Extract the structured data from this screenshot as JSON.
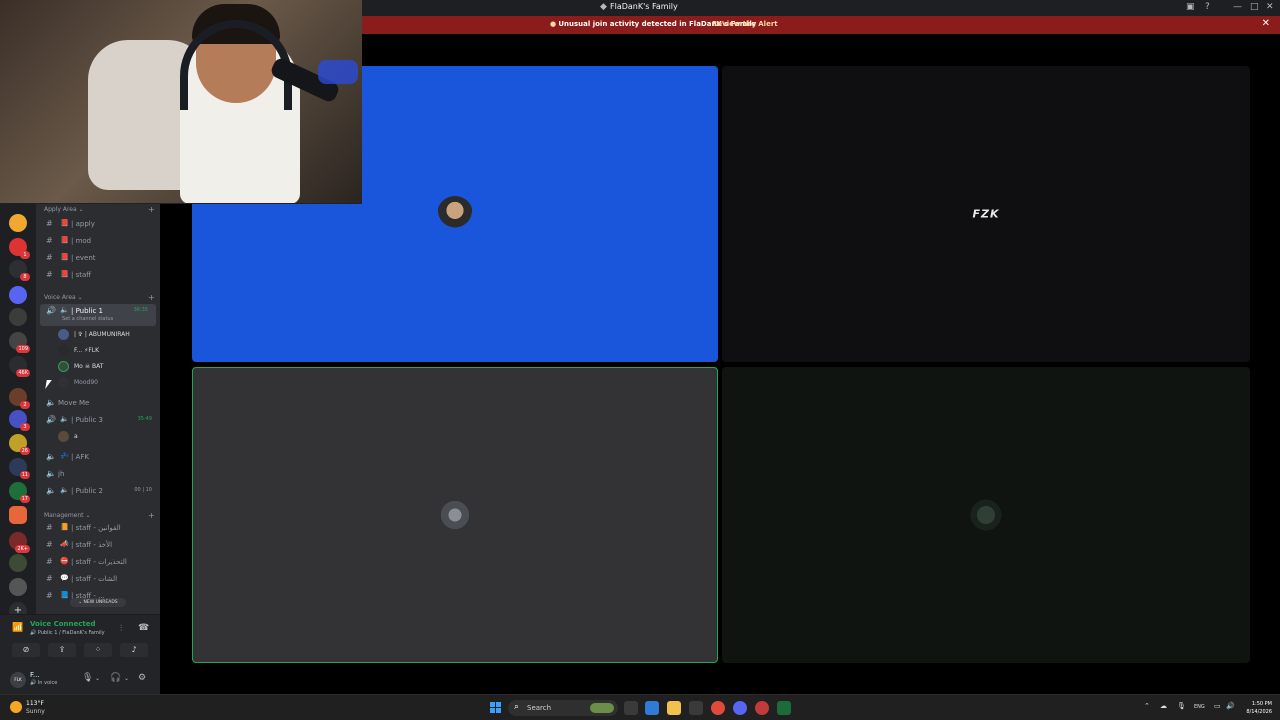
{
  "window": {
    "title": "FlaDanK's Family"
  },
  "alert": {
    "message": "Unusual join activity detected in FlaDanK's Family",
    "action": "Review the Alert"
  },
  "channels": {
    "apply_area": {
      "title": "Apply Area",
      "items": [
        "| apply",
        "| mod",
        "| event",
        "| staff"
      ]
    },
    "voice_area": {
      "title": "Voice Area",
      "public1": {
        "name": "| Public 1",
        "time": "36:35",
        "status": "Set a channel status"
      },
      "members": [
        {
          "name": "| ✞ | ABUMUNIRAH"
        },
        {
          "name": "F... ⚡FLK"
        },
        {
          "name": "Mo  ☠ BAT"
        },
        {
          "name": "Mood90"
        }
      ],
      "move_me": "Move Me",
      "public3": {
        "name": "| Public 3",
        "time": "35:49"
      },
      "public3_member": "a",
      "afk": "| AFK",
      "jh": "jh",
      "public2": {
        "name": "| Public 2",
        "cap_left": "00",
        "cap_right": "10"
      }
    },
    "management": {
      "title": "Management",
      "items": [
        "| staff - القوانين",
        "| staff - الأخذ",
        "| staff - التحذيرات",
        "| staff - الشات",
        "| staff - ..."
      ]
    },
    "new_unreads": "NEW UNREADS"
  },
  "server_badges": [
    "1",
    "8",
    "109",
    "46K",
    "2",
    "3",
    "26",
    "11",
    "17",
    "2K+"
  ],
  "voice": {
    "status": "Voice Connected",
    "location": "Public 1 / FlaDanK's Family"
  },
  "user": {
    "avatar_text": "FLK",
    "name": "F...",
    "status": "In voice"
  },
  "stage": {
    "tiles": [
      {
        "label": "",
        "bg": "#1a56db",
        "speaking": false
      },
      {
        "label": "FZK",
        "bg": "#0f0f12",
        "speaking": false
      },
      {
        "label": "",
        "bg": "#333335",
        "speaking": true
      },
      {
        "label": "",
        "bg": "#101410",
        "speaking": false
      }
    ]
  },
  "taskbar": {
    "temp": "113°F",
    "condition": "Sunny",
    "search_placeholder": "Search",
    "lang": "ENG",
    "time": "1:50 PM",
    "date": "8/14/2026"
  },
  "colors": {
    "accent_green": "#23a55a",
    "alert_red": "#8a1c1c",
    "blue_tile": "#1a56db"
  }
}
